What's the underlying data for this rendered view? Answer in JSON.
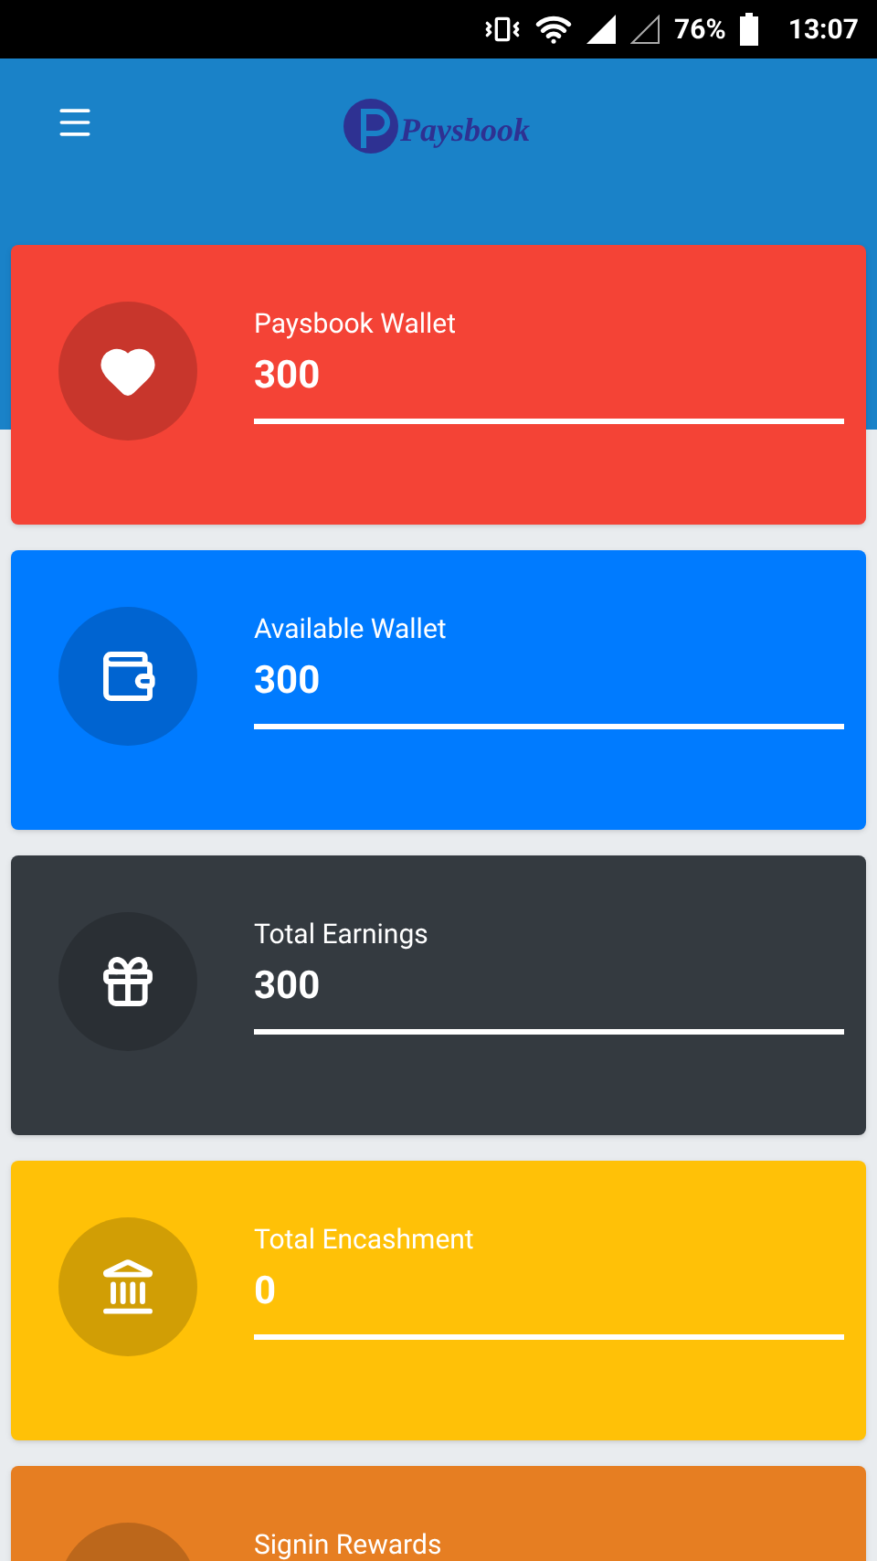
{
  "status_bar": {
    "battery": "76%",
    "time": "13:07"
  },
  "header": {
    "logo_text": "Paysbook"
  },
  "cards": [
    {
      "label": "Paysbook Wallet",
      "value": "300",
      "color": "#f44336",
      "kind": "heart"
    },
    {
      "label": "Available Wallet",
      "value": "300",
      "color": "#007bff",
      "kind": "wallet"
    },
    {
      "label": "Total Earnings",
      "value": "300",
      "color": "#343a40",
      "kind": "gift"
    },
    {
      "label": "Total Encashment",
      "value": "0",
      "color": "#ffc107",
      "kind": "bank"
    },
    {
      "label": "Signin Rewards",
      "color": "#e67e22",
      "kind": "other"
    }
  ]
}
